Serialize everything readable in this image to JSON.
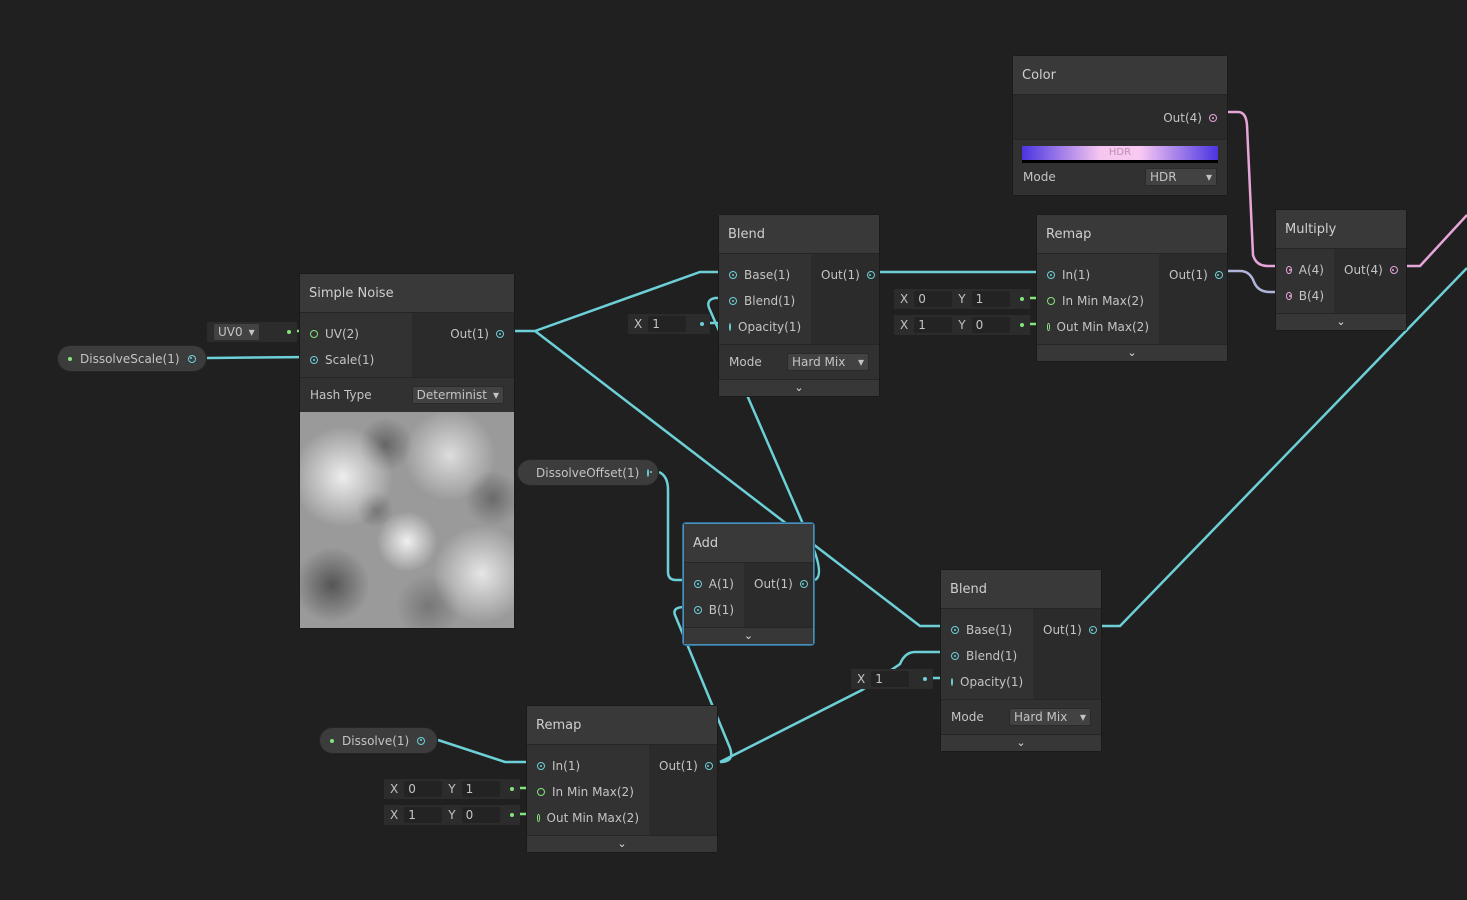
{
  "colors": {
    "float": "#6cd0d6",
    "vector4": "#e8a5d8",
    "vector2": "#84e47c",
    "background": "#202020",
    "selection": "#4d8fb6"
  },
  "nodes": {
    "color": {
      "title": "Color",
      "inputs": [],
      "outputs": [
        "Out(4)"
      ],
      "swatch_label": "HDR",
      "mode_label": "Mode",
      "mode_value": "HDR"
    },
    "multiply": {
      "title": "Multiply",
      "inputs": [
        "A(4)",
        "B(4)"
      ],
      "outputs": [
        "Out(4)"
      ]
    },
    "blend1": {
      "title": "Blend",
      "inputs": [
        "Base(1)",
        "Blend(1)",
        "Opacity(1)"
      ],
      "outputs": [
        "Out(1)"
      ],
      "mode_label": "Mode",
      "mode_value": "Hard Mix"
    },
    "remap1": {
      "title": "Remap",
      "inputs": [
        "In(1)",
        "In Min Max(2)",
        "Out Min Max(2)"
      ],
      "outputs": [
        "Out(1)"
      ]
    },
    "noise": {
      "title": "Simple Noise",
      "inputs": [
        "UV(2)",
        "Scale(1)"
      ],
      "outputs": [
        "Out(1)"
      ],
      "mode_label": "Hash Type",
      "mode_value": "Determinist"
    },
    "add": {
      "title": "Add",
      "inputs": [
        "A(1)",
        "B(1)"
      ],
      "outputs": [
        "Out(1)"
      ]
    },
    "blend2": {
      "title": "Blend",
      "inputs": [
        "Base(1)",
        "Blend(1)",
        "Opacity(1)"
      ],
      "outputs": [
        "Out(1)"
      ],
      "mode_label": "Mode",
      "mode_value": "Hard Mix"
    },
    "remap2": {
      "title": "Remap",
      "inputs": [
        "In(1)",
        "In Min Max(2)",
        "Out Min Max(2)"
      ],
      "outputs": [
        "Out(1)"
      ]
    }
  },
  "properties": {
    "scale": "DissolveScale(1)",
    "offset": "DissolveOffset(1)",
    "dissolve": "Dissolve(1)"
  },
  "fields": {
    "uv": "UV0",
    "blend1_opacity": {
      "x": "1"
    },
    "remap1_in": {
      "x": "0",
      "y": "1"
    },
    "remap1_out": {
      "x": "1",
      "y": "0"
    },
    "blend2_opacity": {
      "x": "1"
    },
    "remap2_in": {
      "x": "0",
      "y": "1"
    },
    "remap2_out": {
      "x": "1",
      "y": "0"
    }
  },
  "labels": {
    "x": "X",
    "y": "Y",
    "chevron": "⌄"
  }
}
